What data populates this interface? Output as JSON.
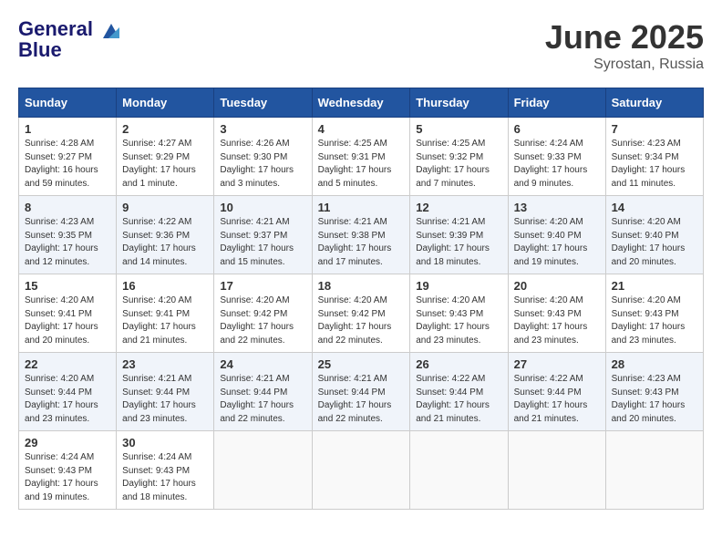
{
  "header": {
    "logo_line1": "General",
    "logo_line2": "Blue",
    "month": "June 2025",
    "location": "Syrostan, Russia"
  },
  "days_of_week": [
    "Sunday",
    "Monday",
    "Tuesday",
    "Wednesday",
    "Thursday",
    "Friday",
    "Saturday"
  ],
  "weeks": [
    [
      {
        "day": "1",
        "info": "Sunrise: 4:28 AM\nSunset: 9:27 PM\nDaylight: 16 hours\nand 59 minutes."
      },
      {
        "day": "2",
        "info": "Sunrise: 4:27 AM\nSunset: 9:29 PM\nDaylight: 17 hours\nand 1 minute."
      },
      {
        "day": "3",
        "info": "Sunrise: 4:26 AM\nSunset: 9:30 PM\nDaylight: 17 hours\nand 3 minutes."
      },
      {
        "day": "4",
        "info": "Sunrise: 4:25 AM\nSunset: 9:31 PM\nDaylight: 17 hours\nand 5 minutes."
      },
      {
        "day": "5",
        "info": "Sunrise: 4:25 AM\nSunset: 9:32 PM\nDaylight: 17 hours\nand 7 minutes."
      },
      {
        "day": "6",
        "info": "Sunrise: 4:24 AM\nSunset: 9:33 PM\nDaylight: 17 hours\nand 9 minutes."
      },
      {
        "day": "7",
        "info": "Sunrise: 4:23 AM\nSunset: 9:34 PM\nDaylight: 17 hours\nand 11 minutes."
      }
    ],
    [
      {
        "day": "8",
        "info": "Sunrise: 4:23 AM\nSunset: 9:35 PM\nDaylight: 17 hours\nand 12 minutes."
      },
      {
        "day": "9",
        "info": "Sunrise: 4:22 AM\nSunset: 9:36 PM\nDaylight: 17 hours\nand 14 minutes."
      },
      {
        "day": "10",
        "info": "Sunrise: 4:21 AM\nSunset: 9:37 PM\nDaylight: 17 hours\nand 15 minutes."
      },
      {
        "day": "11",
        "info": "Sunrise: 4:21 AM\nSunset: 9:38 PM\nDaylight: 17 hours\nand 17 minutes."
      },
      {
        "day": "12",
        "info": "Sunrise: 4:21 AM\nSunset: 9:39 PM\nDaylight: 17 hours\nand 18 minutes."
      },
      {
        "day": "13",
        "info": "Sunrise: 4:20 AM\nSunset: 9:40 PM\nDaylight: 17 hours\nand 19 minutes."
      },
      {
        "day": "14",
        "info": "Sunrise: 4:20 AM\nSunset: 9:40 PM\nDaylight: 17 hours\nand 20 minutes."
      }
    ],
    [
      {
        "day": "15",
        "info": "Sunrise: 4:20 AM\nSunset: 9:41 PM\nDaylight: 17 hours\nand 20 minutes."
      },
      {
        "day": "16",
        "info": "Sunrise: 4:20 AM\nSunset: 9:41 PM\nDaylight: 17 hours\nand 21 minutes."
      },
      {
        "day": "17",
        "info": "Sunrise: 4:20 AM\nSunset: 9:42 PM\nDaylight: 17 hours\nand 22 minutes."
      },
      {
        "day": "18",
        "info": "Sunrise: 4:20 AM\nSunset: 9:42 PM\nDaylight: 17 hours\nand 22 minutes."
      },
      {
        "day": "19",
        "info": "Sunrise: 4:20 AM\nSunset: 9:43 PM\nDaylight: 17 hours\nand 23 minutes."
      },
      {
        "day": "20",
        "info": "Sunrise: 4:20 AM\nSunset: 9:43 PM\nDaylight: 17 hours\nand 23 minutes."
      },
      {
        "day": "21",
        "info": "Sunrise: 4:20 AM\nSunset: 9:43 PM\nDaylight: 17 hours\nand 23 minutes."
      }
    ],
    [
      {
        "day": "22",
        "info": "Sunrise: 4:20 AM\nSunset: 9:44 PM\nDaylight: 17 hours\nand 23 minutes."
      },
      {
        "day": "23",
        "info": "Sunrise: 4:21 AM\nSunset: 9:44 PM\nDaylight: 17 hours\nand 23 minutes."
      },
      {
        "day": "24",
        "info": "Sunrise: 4:21 AM\nSunset: 9:44 PM\nDaylight: 17 hours\nand 22 minutes."
      },
      {
        "day": "25",
        "info": "Sunrise: 4:21 AM\nSunset: 9:44 PM\nDaylight: 17 hours\nand 22 minutes."
      },
      {
        "day": "26",
        "info": "Sunrise: 4:22 AM\nSunset: 9:44 PM\nDaylight: 17 hours\nand 21 minutes."
      },
      {
        "day": "27",
        "info": "Sunrise: 4:22 AM\nSunset: 9:44 PM\nDaylight: 17 hours\nand 21 minutes."
      },
      {
        "day": "28",
        "info": "Sunrise: 4:23 AM\nSunset: 9:43 PM\nDaylight: 17 hours\nand 20 minutes."
      }
    ],
    [
      {
        "day": "29",
        "info": "Sunrise: 4:24 AM\nSunset: 9:43 PM\nDaylight: 17 hours\nand 19 minutes."
      },
      {
        "day": "30",
        "info": "Sunrise: 4:24 AM\nSunset: 9:43 PM\nDaylight: 17 hours\nand 18 minutes."
      },
      {
        "day": "",
        "info": ""
      },
      {
        "day": "",
        "info": ""
      },
      {
        "day": "",
        "info": ""
      },
      {
        "day": "",
        "info": ""
      },
      {
        "day": "",
        "info": ""
      }
    ]
  ]
}
